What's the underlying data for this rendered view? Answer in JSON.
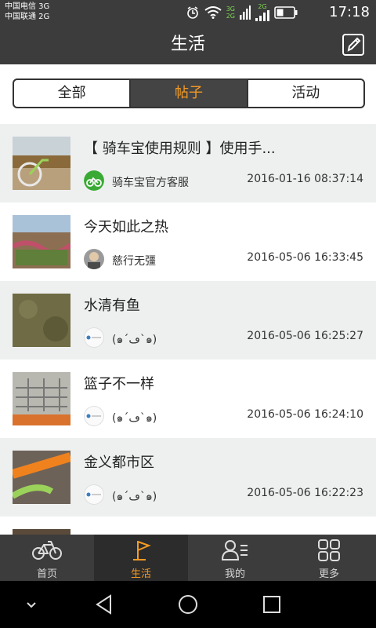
{
  "status_bar": {
    "carrier_1": "中国电信 3G",
    "carrier_2": "中国联通 2G",
    "time": "17:18",
    "net_top": "3G",
    "net_bottom": "2G",
    "net_2g": "2G"
  },
  "header": {
    "title": "生活",
    "edit_icon": "edit-icon"
  },
  "tabs": [
    {
      "label": "全部",
      "active": false
    },
    {
      "label": "帖子",
      "active": true
    },
    {
      "label": "活动",
      "active": false
    }
  ],
  "posts": [
    {
      "title": "【 骑车宝使用规则 】使用手...",
      "author": "骑车宝官方客服",
      "time": "2016-01-16 08:37:14"
    },
    {
      "title": "今天如此之热",
      "author": "慈行无彊",
      "time": "2016-05-06 16:33:45"
    },
    {
      "title": "水清有鱼",
      "author": "(๑´ڡ`๑)",
      "time": "2016-05-06 16:25:27"
    },
    {
      "title": "篮子不一样",
      "author": "(๑´ڡ`๑)",
      "time": "2016-05-06 16:24:10"
    },
    {
      "title": "金义都市区",
      "author": "(๑´ڡ`๑)",
      "time": "2016-05-06 16:22:23"
    }
  ],
  "bottom_nav": [
    {
      "label": "首页",
      "icon": "bicycle-icon",
      "active": false
    },
    {
      "label": "生活",
      "icon": "flag-icon",
      "active": true
    },
    {
      "label": "我的",
      "icon": "profile-icon",
      "active": false
    },
    {
      "label": "更多",
      "icon": "grid-icon",
      "active": false
    }
  ],
  "colors": {
    "bar": "#3c3c3c",
    "accent": "#f59a23",
    "row_shaded": "#eef0f0"
  }
}
